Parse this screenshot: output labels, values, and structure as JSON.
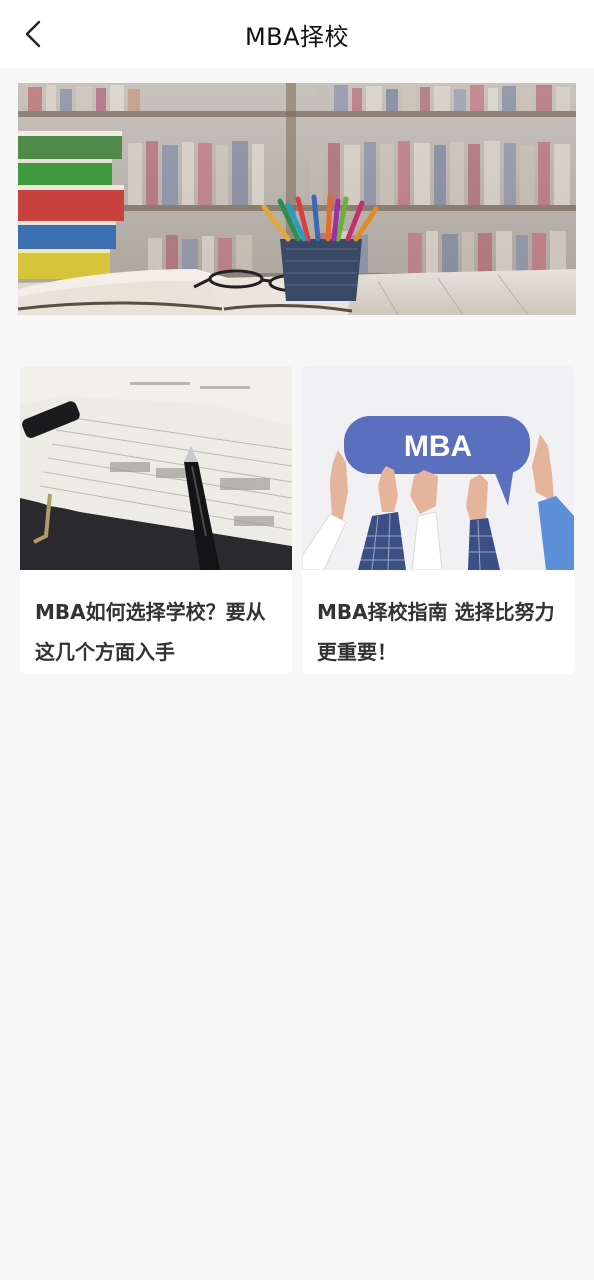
{
  "header": {
    "title": "MBA择校",
    "back_icon": "chevron-left-icon"
  },
  "banner": {
    "description_icon": "banner-books-image"
  },
  "articles": [
    {
      "title": "MBA如何选择学校？要从这几个方面入手",
      "image": "notebook-pen-image"
    },
    {
      "title": "MBA择校指南 选择比努力更重要！",
      "image": "mba-sign-hands-image",
      "sign_text": "MBA"
    }
  ],
  "colors": {
    "background": "#f7f7f7",
    "header_bg": "#ffffff",
    "card_bg": "#ffffff",
    "title_text": "#111111",
    "card_text": "#333333",
    "mba_sign": "#5b6fbf"
  }
}
